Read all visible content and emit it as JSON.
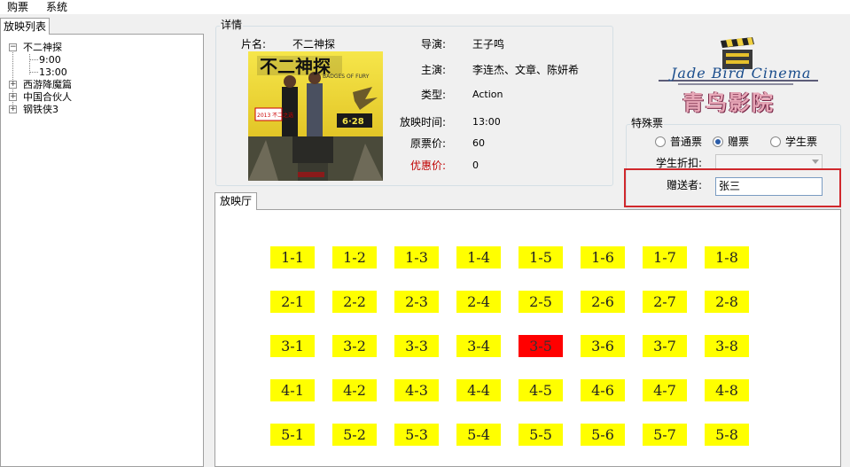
{
  "menu": {
    "buy": "购票",
    "system": "系统"
  },
  "left_tab": {
    "label": "放映列表"
  },
  "tree": {
    "movies": [
      {
        "title": "不二神探",
        "expanded": true,
        "times": [
          "9:00",
          "13:00"
        ]
      },
      {
        "title": "西游降魔篇",
        "expanded": false
      },
      {
        "title": "中国合伙人",
        "expanded": false
      },
      {
        "title": "钢铁侠3",
        "expanded": false
      }
    ]
  },
  "details": {
    "group_title": "详情",
    "title_label": "片名:",
    "title_value": "不二神探",
    "director_label": "导演:",
    "director_value": "王子鸣",
    "actors_label": "主演:",
    "actors_value": "李连杰、文章、陈妍希",
    "type_label": "类型:",
    "type_value": "Action",
    "time_label": "放映时间:",
    "time_value": "13:00",
    "price_label": "原票价:",
    "price_value": "60",
    "discount_label": "优惠价:",
    "discount_value": "0",
    "discount_color": "#c00000"
  },
  "poster": {
    "headline": "不二神探",
    "subtitle": "BADGES OF FURY",
    "date_text": "6·28",
    "promo_text": "2013 不二之选"
  },
  "logo": {
    "english": "Jade Bird Cinema",
    "chinese": "青鸟影院"
  },
  "special": {
    "group_title": "特殊票",
    "options": [
      "普通票",
      "赠票",
      "学生票"
    ],
    "selected": "赠票",
    "student_discount_label": "学生折扣:",
    "giver_label": "赠送者:",
    "giver_value": "张三"
  },
  "hall": {
    "tab_label": "放映厅",
    "available_color": "#ffff00",
    "sold_color": "#ff0000",
    "rows": [
      [
        "1-1",
        "1-2",
        "1-3",
        "1-4",
        "1-5",
        "1-6",
        "1-7",
        "1-8"
      ],
      [
        "2-1",
        "2-2",
        "2-3",
        "2-4",
        "2-5",
        "2-6",
        "2-7",
        "2-8"
      ],
      [
        "3-1",
        "3-2",
        "3-3",
        "3-4",
        "3-5",
        "3-6",
        "3-7",
        "3-8"
      ],
      [
        "4-1",
        "4-2",
        "4-3",
        "4-4",
        "4-5",
        "4-6",
        "4-7",
        "4-8"
      ],
      [
        "5-1",
        "5-2",
        "5-3",
        "5-4",
        "5-5",
        "5-6",
        "5-7",
        "5-8"
      ]
    ],
    "sold_seats": [
      "3-5"
    ]
  }
}
